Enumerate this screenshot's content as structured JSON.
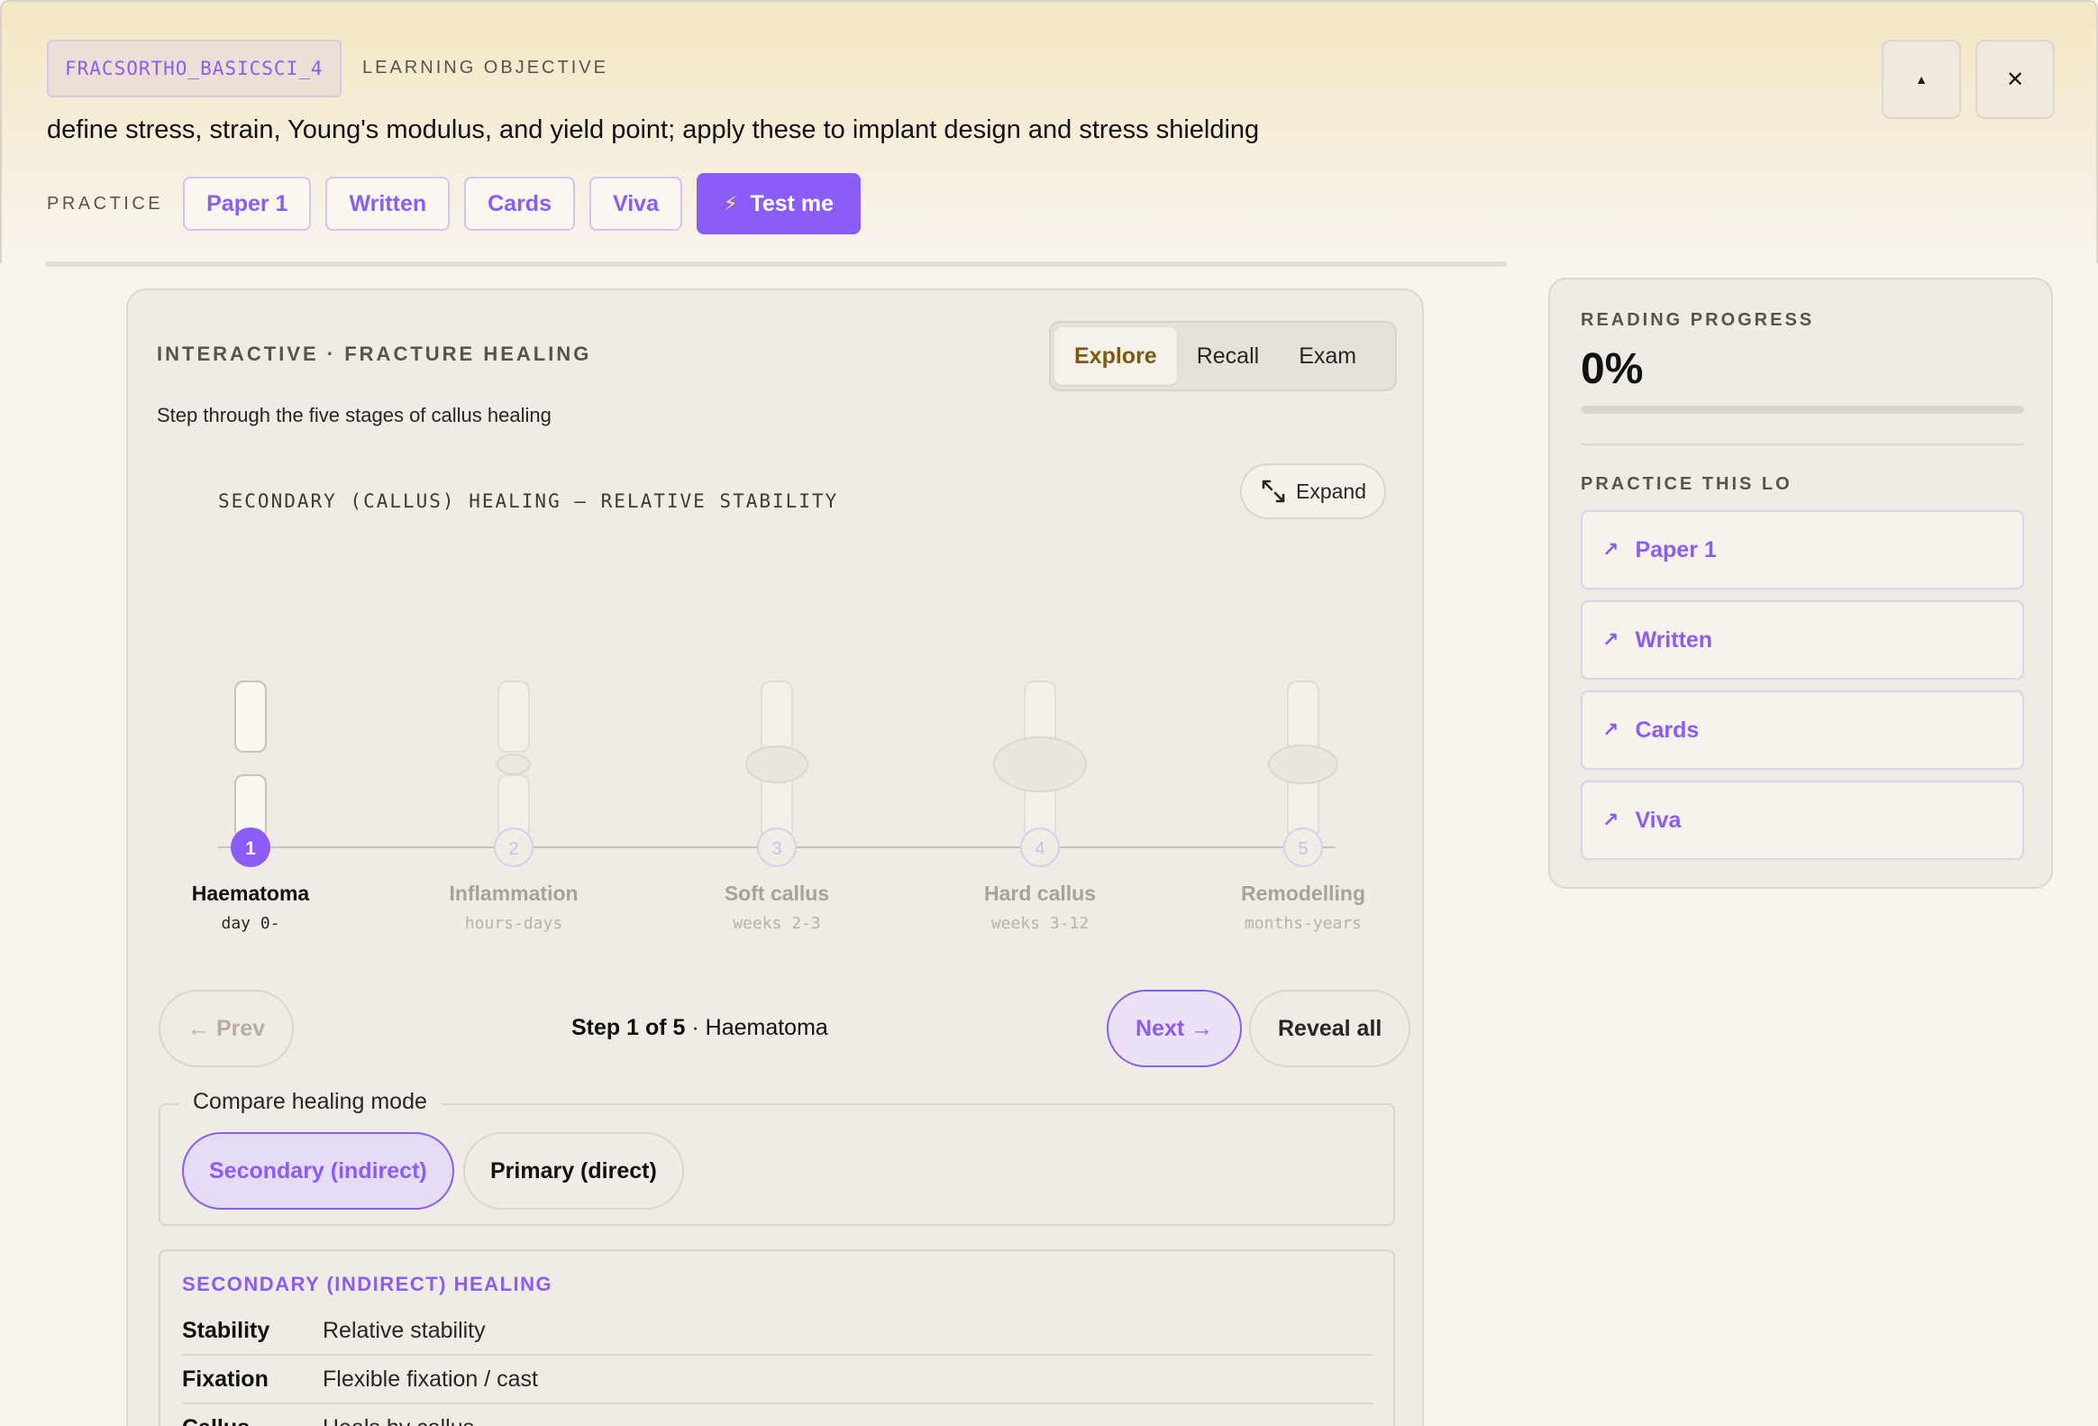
{
  "header": {
    "lo_code": "FRACSORTHO_BASICSCI_4",
    "lo_label": "LEARNING OBJECTIVE",
    "lo_title": "define stress, strain, Young's modulus, and yield point; apply these to implant design and stress shielding",
    "practice_label": "PRACTICE",
    "practice_buttons": [
      "Paper 1",
      "Written",
      "Cards",
      "Viva"
    ],
    "test_me": "Test me",
    "collapse_glyph": "▲",
    "close_glyph": "✕"
  },
  "card": {
    "title": "INTERACTIVE · FRACTURE HEALING",
    "segments": [
      "Explore",
      "Recall",
      "Exam"
    ],
    "active_segment": "Explore",
    "subtitle": "Step through the five stages of callus healing",
    "diagram_title": "SECONDARY (CALLUS) HEALING — RELATIVE STABILITY",
    "expand": "Expand",
    "stages": [
      {
        "num": "1",
        "name": "Haematoma",
        "time": "day 0-"
      },
      {
        "num": "2",
        "name": "Inflammation",
        "time": "hours-days"
      },
      {
        "num": "3",
        "name": "Soft callus",
        "time": "weeks 2-3"
      },
      {
        "num": "4",
        "name": "Hard callus",
        "time": "weeks 3-12"
      },
      {
        "num": "5",
        "name": "Remodelling",
        "time": "months-years"
      }
    ],
    "current_step": 1,
    "prev": "← Prev",
    "next": "Next →",
    "reveal_all": "Reveal all",
    "step_of": "Step 1 of 5",
    "step_name": "· Haematoma",
    "compare_legend": "Compare healing mode",
    "modes": [
      "Secondary (indirect)",
      "Primary (direct)"
    ],
    "active_mode": "Secondary (indirect)",
    "info_title": "SECONDARY (INDIRECT) HEALING",
    "info_rows": [
      {
        "key": "Stability",
        "value": "Relative stability"
      },
      {
        "key": "Fixation",
        "value": "Flexible fixation / cast"
      },
      {
        "key": "Callus",
        "value": "Heals by callus"
      }
    ]
  },
  "sidebar": {
    "progress_label": "READING PROGRESS",
    "progress_text": "0%",
    "progress_value": 0,
    "practice_label": "PRACTICE THIS LO",
    "links": [
      "Paper 1",
      "Written",
      "Cards",
      "Viva"
    ]
  },
  "colors": {
    "accent": "#8b5cf6",
    "explore_active": "#7c5a12"
  }
}
